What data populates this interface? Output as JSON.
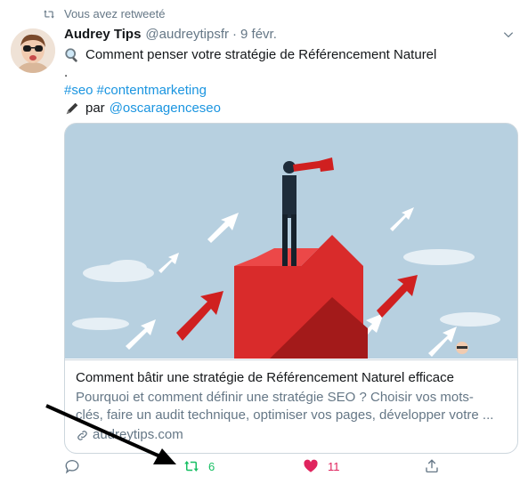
{
  "retweet_header": {
    "text": "Vous avez retweeté",
    "icon": "retweet-icon"
  },
  "tweet": {
    "author_name": "Audrey Tips",
    "handle": "@audreytipsfr",
    "separator": "·",
    "date": "9 févr.",
    "line1": {
      "icon": "magnifier-emoji",
      "text": "Comment penser votre stratégie de Référencement Naturel"
    },
    "line2": ".",
    "hashtags": [
      "#seo",
      "#contentmarketing"
    ],
    "credit": {
      "icon": "pen-emoji",
      "prefix": "par",
      "mention": "@oscaragenceseo"
    }
  },
  "card": {
    "title": "Comment bâtir une stratégie de Référencement Naturel efficace",
    "description_line1": "Pourquoi et comment définir une stratégie SEO ? Choisir vos mots-",
    "description_line2": "clés, faire un audit technique, optimiser vos pages, développer votre ...",
    "domain": "audreytips.com",
    "image_icon": "illustration-man-with-spyglass-on-red-arrows"
  },
  "actions": {
    "reply": {
      "icon": "reply-icon",
      "count": ""
    },
    "retweet": {
      "icon": "retweet-icon",
      "count": "6",
      "color": "#17bf63"
    },
    "like": {
      "icon": "heart-icon",
      "count": "11",
      "color": "#e0245e"
    },
    "share": {
      "icon": "share-icon"
    }
  },
  "colors": {
    "link": "#1b95e0",
    "secondary_text": "#657786",
    "border": "#ccd6dd"
  }
}
